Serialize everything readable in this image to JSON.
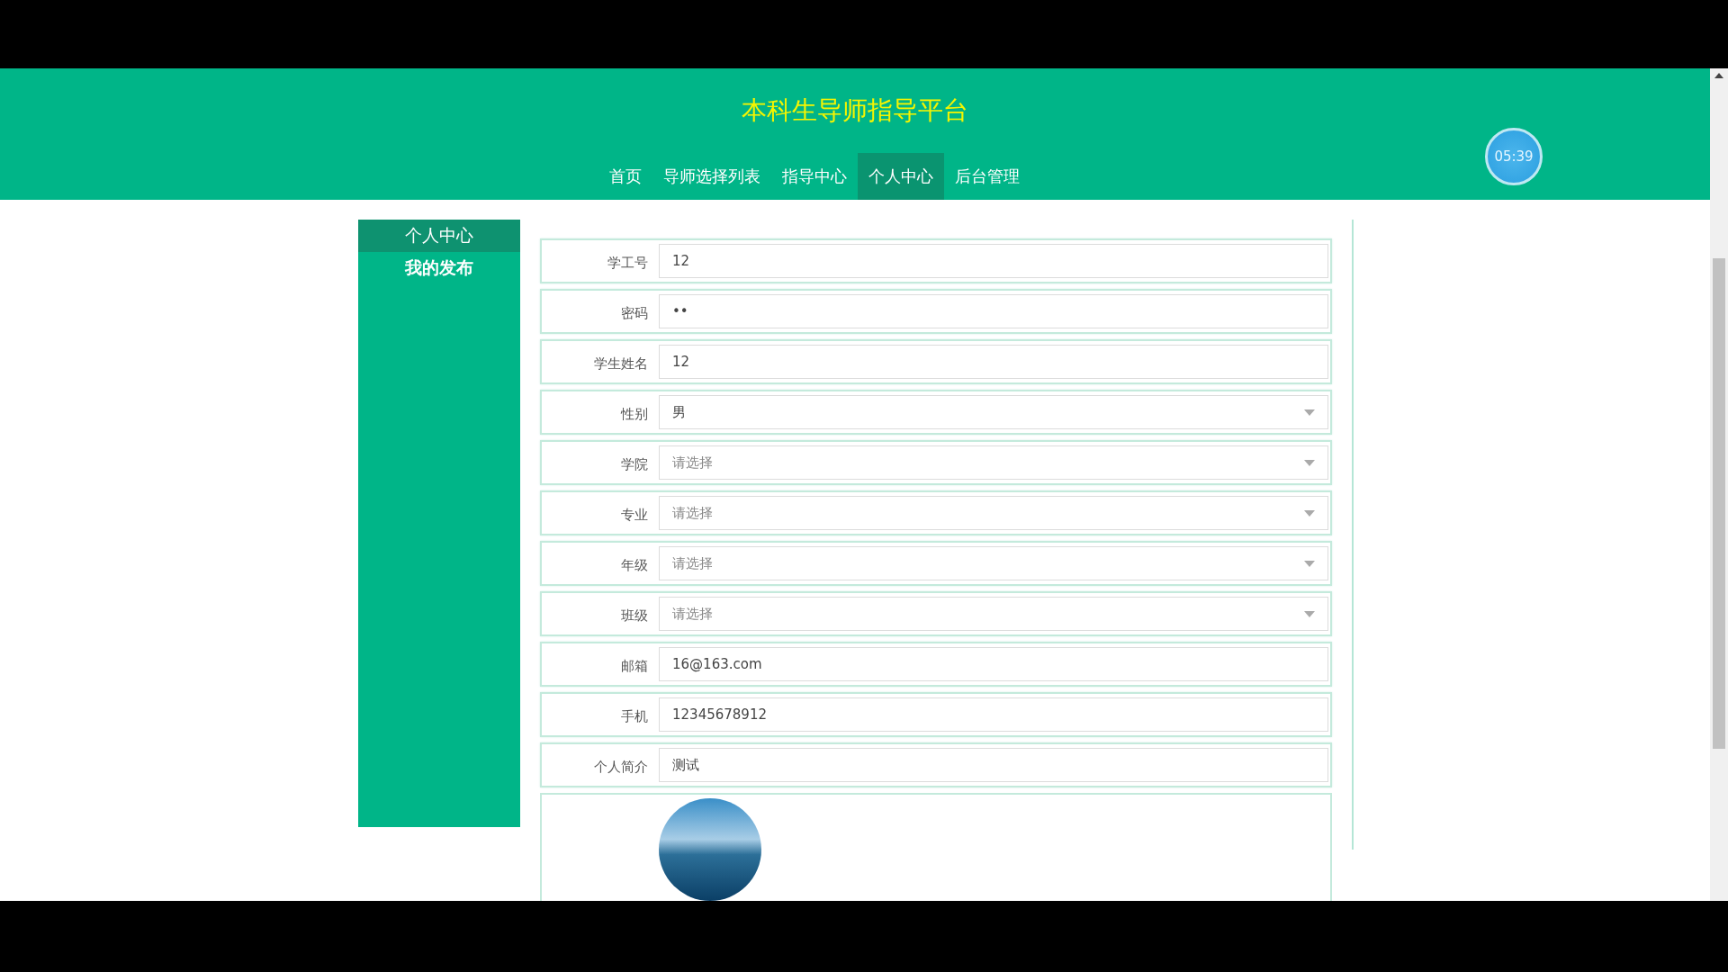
{
  "header": {
    "title": "本科生导师指导平台",
    "timer": "05:39"
  },
  "nav": [
    {
      "label": "首页",
      "selected": false
    },
    {
      "label": "导师选择列表",
      "selected": false
    },
    {
      "label": "指导中心",
      "selected": false
    },
    {
      "label": "个人中心",
      "selected": true
    },
    {
      "label": "后台管理",
      "selected": false
    }
  ],
  "sidebar": {
    "items": [
      {
        "label": "个人中心",
        "selected": true
      },
      {
        "label": "我的发布",
        "selected": false
      }
    ]
  },
  "form": {
    "fields": [
      {
        "kind": "input",
        "label": "学工号",
        "value": "12"
      },
      {
        "kind": "input",
        "label": "密码",
        "value": "••"
      },
      {
        "kind": "input",
        "label": "学生姓名",
        "value": "12"
      },
      {
        "kind": "select",
        "label": "性别",
        "value": "男"
      },
      {
        "kind": "select",
        "label": "学院",
        "placeholder": "请选择"
      },
      {
        "kind": "select",
        "label": "专业",
        "placeholder": "请选择"
      },
      {
        "kind": "select",
        "label": "年级",
        "placeholder": "请选择"
      },
      {
        "kind": "select",
        "label": "班级",
        "placeholder": "请选择"
      },
      {
        "kind": "input",
        "label": "邮箱",
        "value": "16@163.com"
      },
      {
        "kind": "input",
        "label": "手机",
        "value": "12345678912"
      },
      {
        "kind": "input",
        "label": "个人简介",
        "value": "测试"
      },
      {
        "kind": "photo"
      }
    ]
  }
}
